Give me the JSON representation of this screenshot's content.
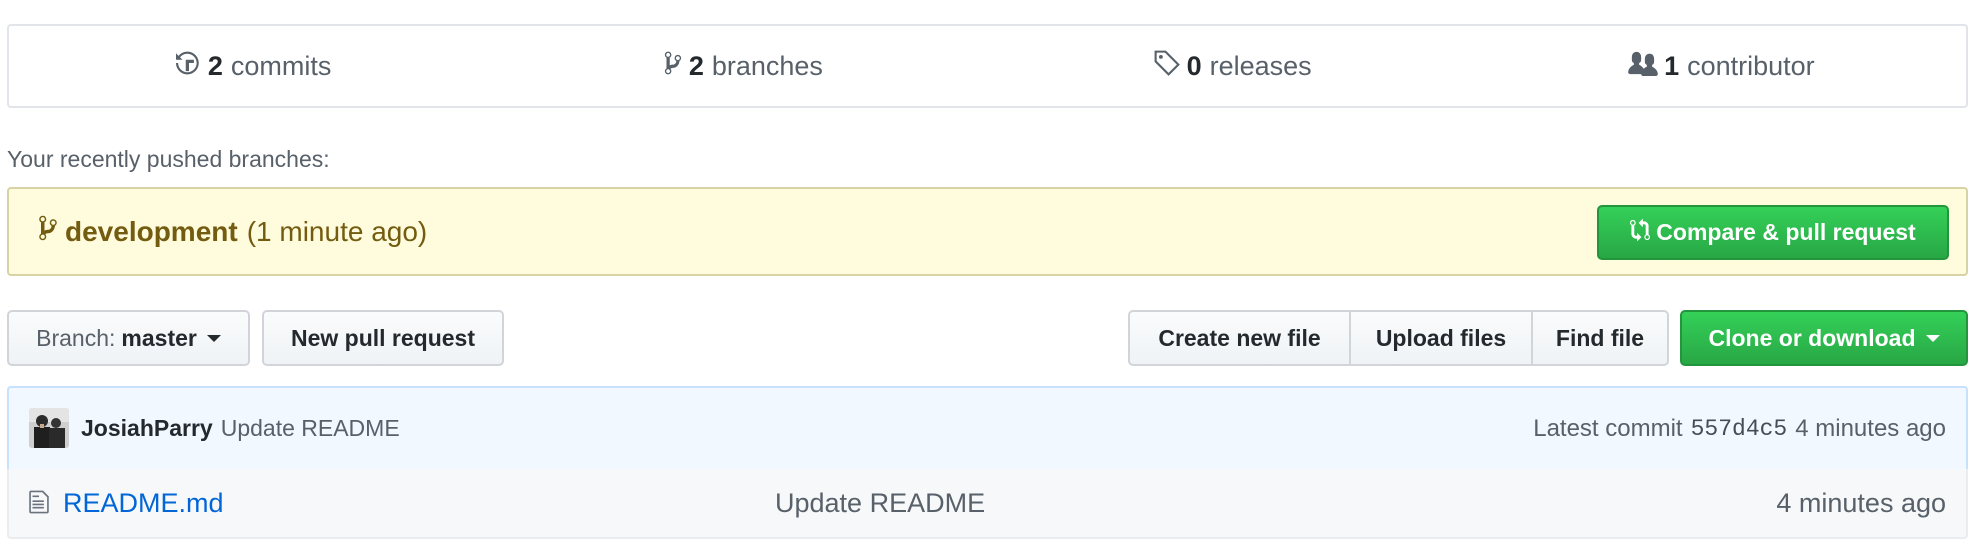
{
  "summary": {
    "commits": {
      "count": "2",
      "label": "commits",
      "icon": "history-icon"
    },
    "branches": {
      "count": "2",
      "label": "branches",
      "icon": "git-branch-icon"
    },
    "releases": {
      "count": "0",
      "label": "releases",
      "icon": "tag-icon"
    },
    "contributors": {
      "count": "1",
      "label": "contributor",
      "icon": "people-icon"
    }
  },
  "recent": {
    "label": "Your recently pushed branches:",
    "branch_name": "development",
    "branch_time": "(1 minute ago)",
    "compare_button": "Compare & pull request"
  },
  "nav": {
    "branch_prefix": "Branch:",
    "branch_value": "master",
    "new_pr": "New pull request",
    "create_file": "Create new file",
    "upload_files": "Upload files",
    "find_file": "Find file",
    "clone": "Clone or download"
  },
  "commit": {
    "author": "JosiahParry",
    "message": "Update README",
    "latest_prefix": "Latest commit",
    "sha": "557d4c5",
    "age": "4 minutes ago"
  },
  "files": [
    {
      "name": "README.md",
      "message": "Update README",
      "age": "4 minutes ago",
      "icon": "file-icon"
    }
  ],
  "colors": {
    "accent_green": "#28a745",
    "link_blue": "#0366d6",
    "notice_bg": "#fffbdd",
    "commit_bg": "#f1f8ff"
  }
}
